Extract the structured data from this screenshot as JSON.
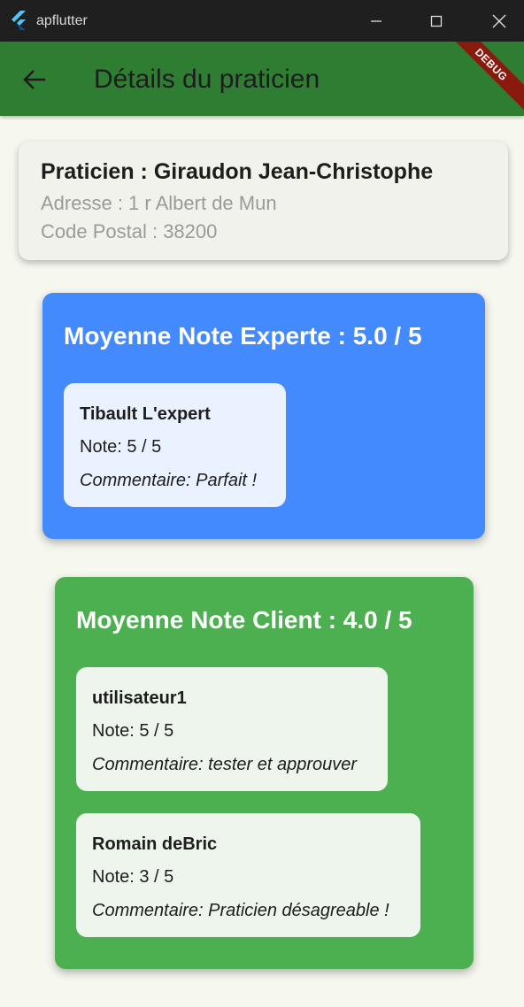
{
  "window": {
    "title": "apflutter",
    "icons": {
      "app": "flutter-logo-icon",
      "minimize": "minimize-icon",
      "maximize": "maximize-icon",
      "close": "close-icon"
    }
  },
  "appbar": {
    "title": "Détails du praticien",
    "back_icon": "arrow-left-icon",
    "color": "#2e7d32",
    "debug_banner": "DEBUG"
  },
  "praticien": {
    "title": "Praticien : Giraudon Jean-Christophe",
    "address": "Adresse : 1 r Albert de Mun",
    "postal_code": "Code Postal : 38200"
  },
  "expert": {
    "title": "Moyenne Note Experte : 5.0 / 5",
    "color": "#448aff",
    "reviews": [
      {
        "author": "Tibault L'expert",
        "note": "Note: 5 / 5",
        "comment": "Commentaire: Parfait !"
      }
    ]
  },
  "client": {
    "title": "Moyenne Note Client : 4.0 / 5",
    "color": "#4caf50",
    "reviews": [
      {
        "author": "utilisateur1",
        "note": "Note: 5 / 5",
        "comment": "Commentaire: tester et approuver"
      },
      {
        "author": "Romain deBric",
        "note": "Note: 3 / 5",
        "comment": "Commentaire: Praticien désagreable !"
      }
    ]
  }
}
